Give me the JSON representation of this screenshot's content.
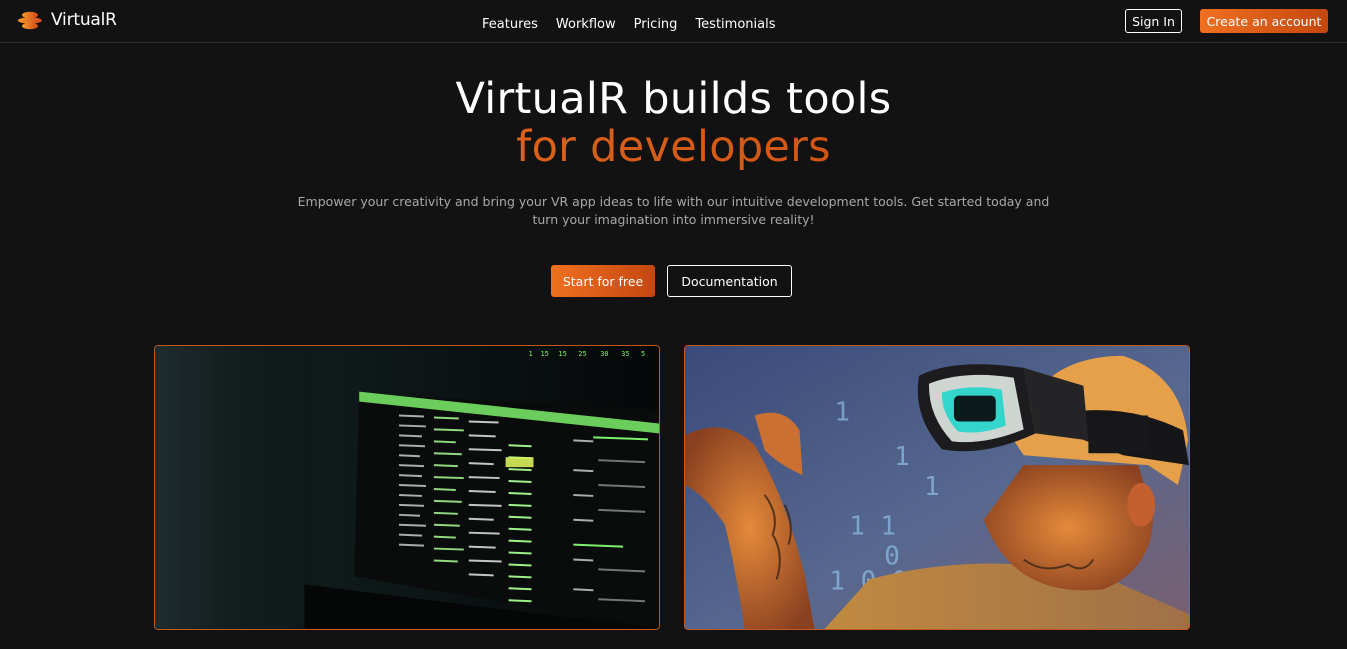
{
  "brand": {
    "name": "VirtualR",
    "logo_icon": "layered-disc-icon"
  },
  "nav": {
    "links": [
      {
        "label": "Features"
      },
      {
        "label": "Workflow"
      },
      {
        "label": "Pricing"
      },
      {
        "label": "Testimonials"
      }
    ],
    "sign_in_label": "Sign In",
    "create_account_label": "Create an account"
  },
  "hero": {
    "title_line1": "VirtualR builds tools",
    "title_line2": "for developers",
    "subtitle": "Empower your creativity and bring your VR app ideas to life with our intuitive development tools. Get started today and turn your imagination into immersive reality!",
    "primary_cta": "Start for free",
    "secondary_cta": "Documentation"
  },
  "images": [
    {
      "depicts": "terminal-monitor-photo"
    },
    {
      "depicts": "vr-headset-person-photo"
    }
  ],
  "colors": {
    "background": "#121212",
    "accent_start": "#f07020",
    "accent_end": "#c4470f",
    "card_border": "#c4581f",
    "subtitle_text": "#a8a8a8"
  }
}
